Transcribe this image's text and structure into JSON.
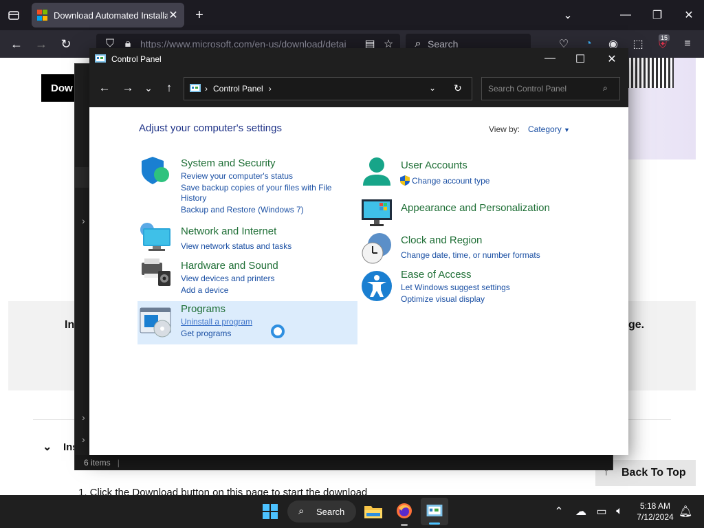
{
  "browser": {
    "tab_title": "Download Automated Installatio",
    "url": "https://www.microsoft.com/en-us/download/detai",
    "search_placeholder": "Search",
    "notifications_badge": "15"
  },
  "webpage": {
    "download_button": "Dow",
    "partial_heading_left": "In",
    "partial_heading_right": "ge.",
    "partial_section": "Ins",
    "step_text": "1. Click the Download button on this page to start the download",
    "back_to_top": "Back To Top"
  },
  "control_panel": {
    "window_title": "Control Panel",
    "address_label": "Control Panel",
    "search_placeholder": "Search Control Panel",
    "heading": "Adjust your computer's settings",
    "view_by_label": "View by:",
    "view_by_value": "Category",
    "categories": [
      {
        "title": "System and Security",
        "links": [
          "Review your computer's status",
          "Save backup copies of your files with File",
          "History",
          "Backup and Restore (Windows 7)"
        ]
      },
      {
        "title": "Network and Internet",
        "links": [
          "View network status and tasks"
        ]
      },
      {
        "title": "Hardware and Sound",
        "links": [
          "View devices and printers",
          "Add a device"
        ]
      },
      {
        "title": "Programs",
        "links": [
          "Uninstall a program",
          "Get programs"
        ]
      },
      {
        "title": "User Accounts",
        "links": [
          "Change account type"
        ]
      },
      {
        "title": "Appearance and Personalization",
        "links": []
      },
      {
        "title": "Clock and Region",
        "links": [
          "Change date, time, or number formats"
        ]
      },
      {
        "title": "Ease of Access",
        "links": [
          "Let Windows suggest settings",
          "Optimize visual display"
        ]
      }
    ],
    "status_items": "6 items"
  },
  "taskbar": {
    "search_label": "Search",
    "time": "5:18 AM",
    "date": "7/12/2024"
  },
  "colors": {
    "accent": "#1e6e35",
    "link": "#1a4fa3",
    "heading": "#1e3287",
    "dark_chrome": "#1f1f1f"
  }
}
